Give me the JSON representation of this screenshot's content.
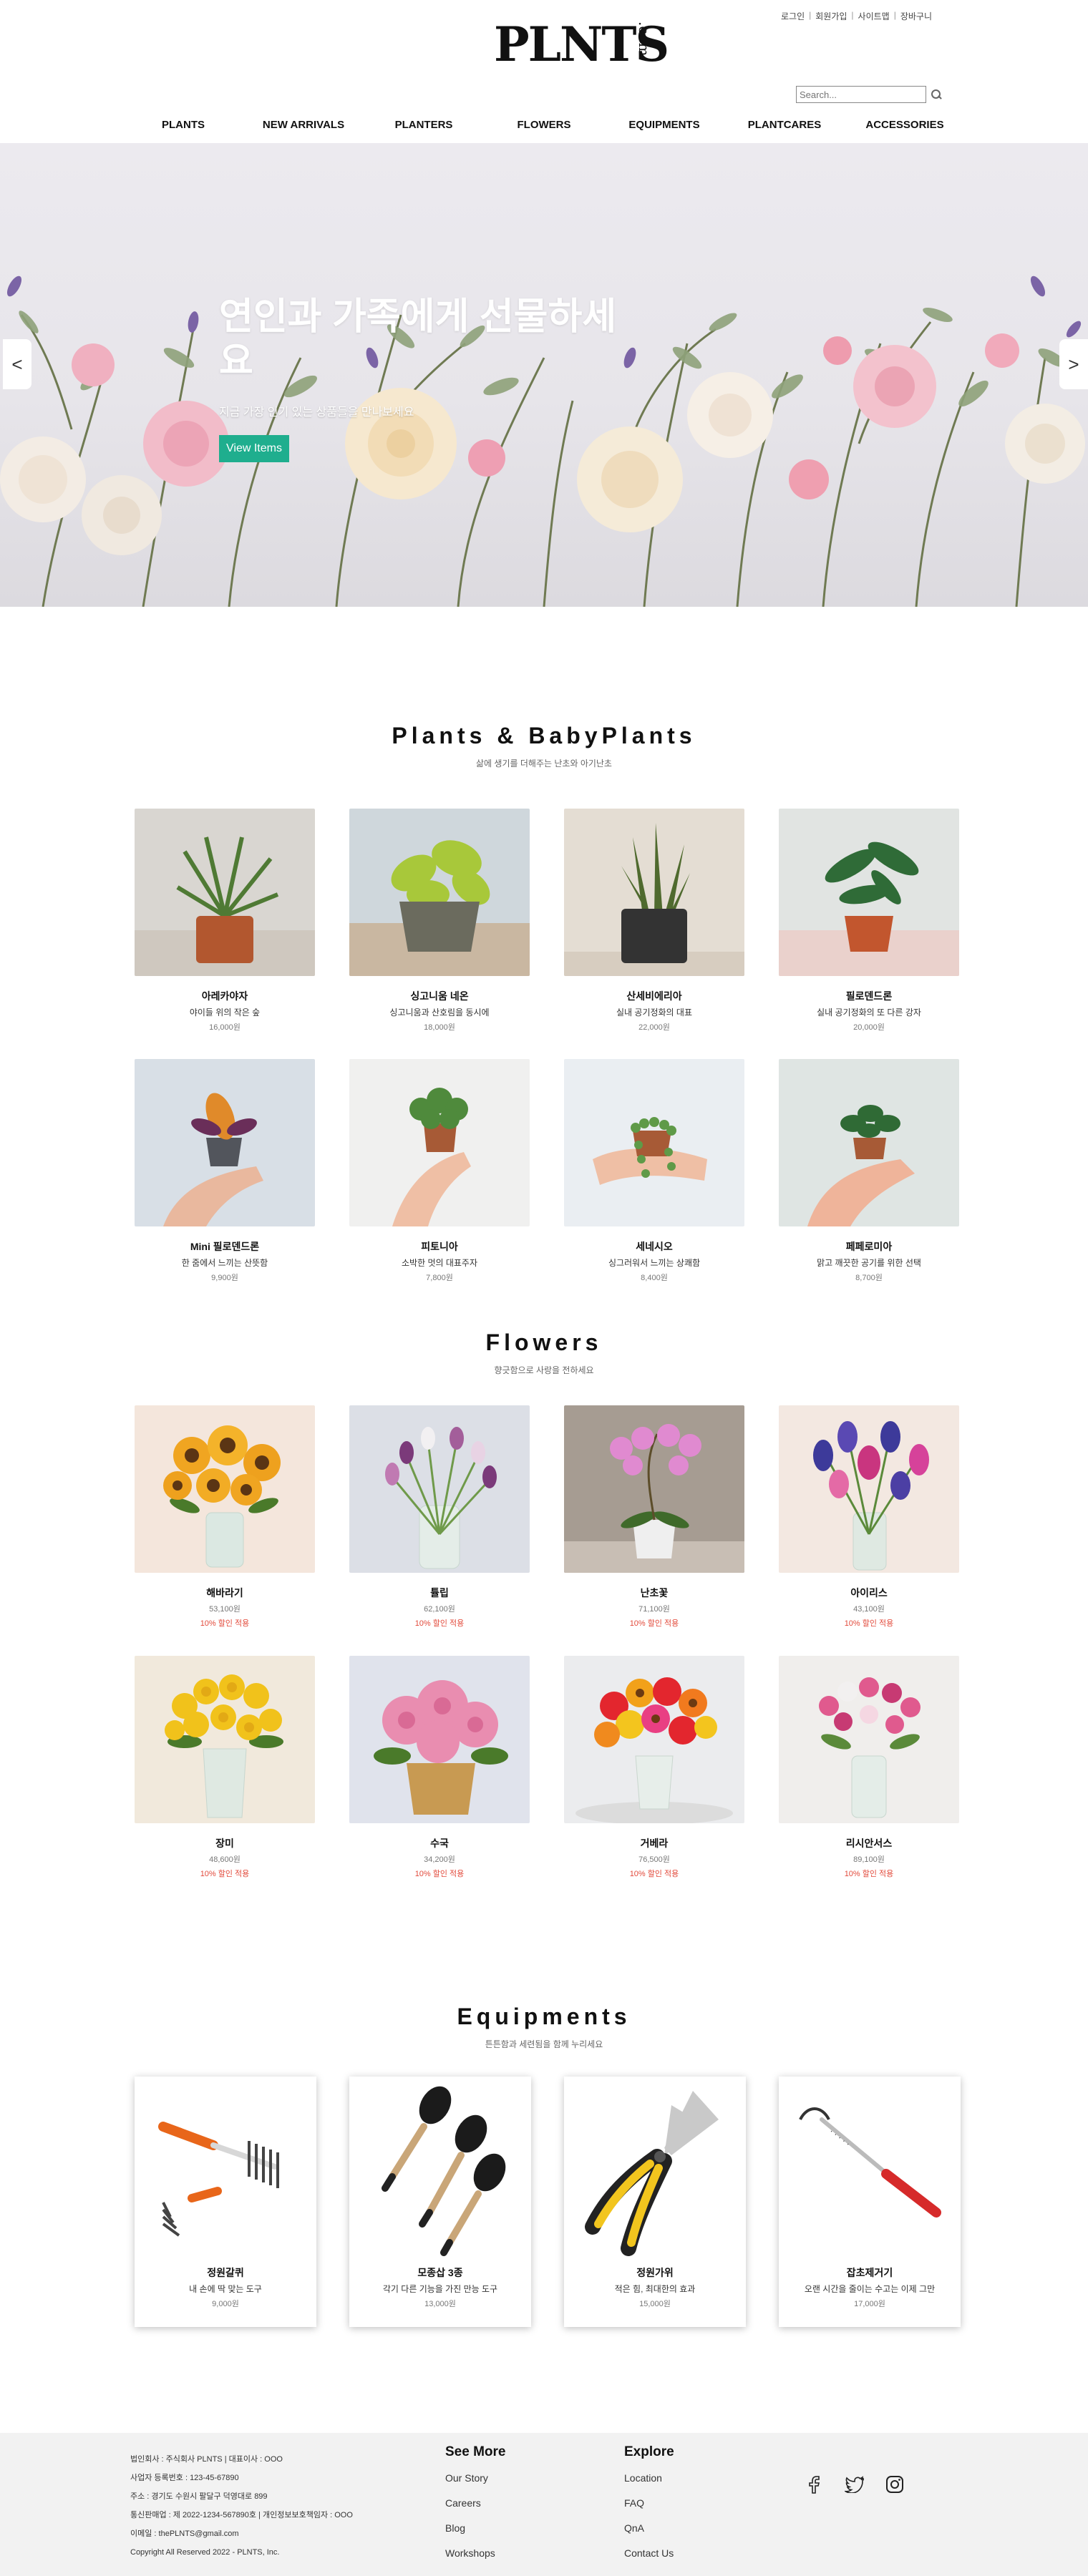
{
  "header": {
    "logo": "PLNTS",
    "logo_suffix": ".com",
    "util_links": [
      "로그인",
      "회원가입",
      "사이트맵",
      "장바구니"
    ],
    "search_placeholder": "Search...",
    "nav": [
      "PLANTS",
      "NEW ARRIVALS",
      "PLANTERS",
      "FLOWERS",
      "EQUIPMENTS",
      "PLANTCARES",
      "ACCESSORIES"
    ]
  },
  "hero": {
    "title": "연인과 가족에게 선물하세요",
    "subtitle": "지금 가장 인기 있는 상품들을 만나보세요",
    "button": "View Items",
    "prev": "<",
    "next": ">"
  },
  "plants": {
    "title": "Plants & BabyPlants",
    "subtitle": "삶에 생기를 더해주는 난초와 아기난초",
    "items": [
      {
        "name": "아레카야자",
        "desc": "야이들 위의 작은 숲",
        "price": "16,000원"
      },
      {
        "name": "싱고니움 네온",
        "desc": "싱고니움과 산호림을 동시에",
        "price": "18,000원"
      },
      {
        "name": "산세비에리아",
        "desc": "실내 공기정화의 대표",
        "price": "22,000원"
      },
      {
        "name": "필로덴드론",
        "desc": "실내 공기정화의 또 다른 강자",
        "price": "20,000원"
      },
      {
        "name": "Mini 필로덴드론",
        "desc": "한 줌에서 느끼는 산뜻함",
        "price": "9,900원"
      },
      {
        "name": "피토니아",
        "desc": "소박한 멋의 대표주자",
        "price": "7,800원"
      },
      {
        "name": "세네시오",
        "desc": "싱그러워서 느끼는 상쾌함",
        "price": "8,400원"
      },
      {
        "name": "페페로미아",
        "desc": "맑고 깨끗한 공기를 위한 선택",
        "price": "8,700원"
      }
    ]
  },
  "flowers": {
    "title": "Flowers",
    "subtitle": "향긋함으로 사랑을 전하세요",
    "items": [
      {
        "name": "해바라기",
        "price": "53,100원",
        "sale": "10% 할인 적용"
      },
      {
        "name": "튤립",
        "price": "62,100원",
        "sale": "10% 할인 적용"
      },
      {
        "name": "난초꽃",
        "price": "71,100원",
        "sale": "10% 할인 적용"
      },
      {
        "name": "아이리스",
        "price": "43,100원",
        "sale": "10% 할인 적용"
      },
      {
        "name": "장미",
        "price": "48,600원",
        "sale": "10% 할인 적용"
      },
      {
        "name": "수국",
        "price": "34,200원",
        "sale": "10% 할인 적용"
      },
      {
        "name": "거베라",
        "price": "76,500원",
        "sale": "10% 할인 적용"
      },
      {
        "name": "리시안서스",
        "price": "89,100원",
        "sale": "10% 할인 적용"
      }
    ]
  },
  "equipments": {
    "title": "Equipments",
    "subtitle": "튼튼함과 세련됨을 함께 누리세요",
    "items": [
      {
        "name": "정원갈퀴",
        "desc": "내 손에 딱 맞는 도구",
        "price": "9,000원"
      },
      {
        "name": "모종삽 3종",
        "desc": "각기 다른 기능을 가진 만능 도구",
        "price": "13,000원"
      },
      {
        "name": "정원가위",
        "desc": "적은 힘, 최대한의 효과",
        "price": "15,000원"
      },
      {
        "name": "잡초제거기",
        "desc": "오랜 시간을 줄이는 수고는 이제 그만",
        "price": "17,000원"
      }
    ]
  },
  "footer": {
    "info": [
      "법인회사 : 주식회사 PLNTS | 대표이사 : OOO",
      "사업자 등록번호 : 123-45-67890",
      "주소 : 경기도 수원시 팔달구 덕영대로 899",
      "통신판매업 : 제 2022-1234-567890호 | 개인정보보호책임자 : OOO",
      "이메일 : thePLNTS@gmail.com",
      "Copyright All Reserved 2022 - PLNTS, Inc."
    ],
    "see_more": {
      "title": "See More",
      "links": [
        "Our Story",
        "Careers",
        "Blog",
        "Workshops"
      ]
    },
    "explore": {
      "title": "Explore",
      "links": [
        "Location",
        "FAQ",
        "QnA",
        "Contact Us"
      ]
    },
    "social": [
      "facebook-icon",
      "twitter-icon",
      "instagram-icon"
    ]
  }
}
